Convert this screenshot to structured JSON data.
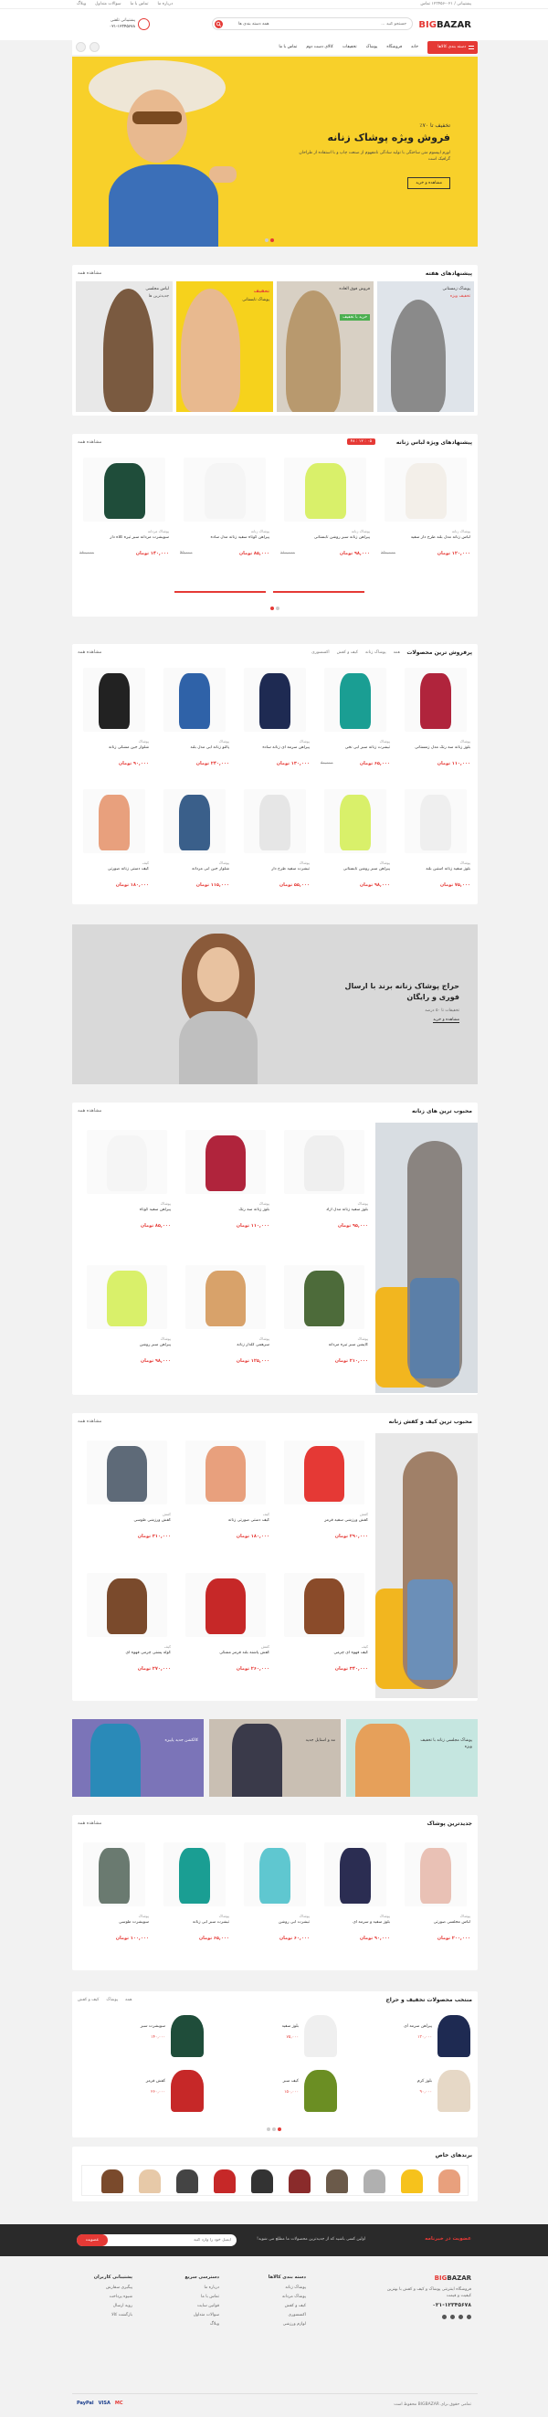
{
  "topbar": {
    "right_text": "پشتیبانی / ۰۲۱-۱۲۳۴۵۶ تماس",
    "left_links": [
      "درباره ما",
      "تماس با ما",
      "سوالات متداول",
      "وبلاگ"
    ]
  },
  "header": {
    "logo": "BIGBAZAR",
    "search_placeholder": "جستجو کنید ...",
    "category_select": "همه دسته بندی ها",
    "support_line1": "پشتیبانی تلفنی",
    "support_line2": "۰۲۱-۱۲۳۴۵۶۷۸"
  },
  "nav": {
    "all_categories": "دسته بندی کالاها",
    "items": [
      "خانه",
      "فروشگاه",
      "پوشاک",
      "تخفیفات",
      "کالای دست دوم",
      "تماس با ما"
    ]
  },
  "hero": {
    "subtitle": "تخفیف تا ۷۰٪",
    "title": "فروش ویژه پوشاک زنانه",
    "desc": "لورم ایپسوم متن ساختگی با تولید سادگی نامفهوم از صنعت چاپ و با استفاده از طراحان گرافیک است",
    "button": "مشاهده و خرید"
  },
  "special": {
    "title": "پیشنهادهای هفته",
    "see_all": "مشاهده همه",
    "tiles": [
      {
        "line1": "پوشاک زمستانی",
        "line2": "تخفیف ویژه",
        "bg": "#dfe4ea"
      },
      {
        "line1": "فروش فوق العاده",
        "line2": "خرید با تخفیف",
        "bg": "#d8d0c4"
      },
      {
        "line1": "تخفیف",
        "line2": "پوشاک تابستانی",
        "bg": "#f6d21c"
      },
      {
        "line1": "لباس مجلسی",
        "line2": "جدیدترین ها",
        "bg": "#e8e8e8"
      }
    ]
  },
  "amazing": {
    "title": "پیشنهادهای ویژه لباس زنانه",
    "timer": "۰۵ : ۱۲ : ۴۸",
    "see_all": "مشاهده همه",
    "products": [
      {
        "cat": "پوشاک زنانه",
        "title": "لباس زنانه مدل بلند طرح دار سفید",
        "price": "۱۲۰,۰۰۰ تومان",
        "old": "۱۵۰,۰۰۰",
        "color": "#f3efe9"
      },
      {
        "cat": "پوشاک زنانه",
        "title": "پیراهن زنانه سبز روشن تابستانی",
        "price": "۹۸,۰۰۰ تومان",
        "old": "۱۱۰,۰۰۰",
        "color": "#d9f06a"
      },
      {
        "cat": "پوشاک زنانه",
        "title": "پیراهن کوتاه سفید زنانه مدل ساده",
        "price": "۸۵,۰۰۰ تومان",
        "old": "۹۵,۰۰۰",
        "color": "#f5f5f5"
      },
      {
        "cat": "پوشاک مردانه",
        "title": "سویشرت مردانه سبز تیره کلاه دار",
        "price": "۱۴۰,۰۰۰ تومان",
        "old": "۱۶۰,۰۰۰",
        "color": "#1f4d3a"
      }
    ]
  },
  "bestsellers": {
    "title": "پرفروش ترین محصولات",
    "tabs": [
      "همه",
      "پوشاک زنانه",
      "کیف و کفش",
      "اکسسوری"
    ],
    "see_all": "مشاهده همه",
    "products": [
      {
        "cat": "پوشاک",
        "title": "بلوز زنانه سه رنگ مدل زمستانی",
        "price": "۱۱۰,۰۰۰ تومان",
        "old": "",
        "color": "#b0243c"
      },
      {
        "cat": "پوشاک",
        "title": "تیشرت زنانه سبز آبی نخی",
        "price": "۶۵,۰۰۰ تومان",
        "old": "۸۰,۰۰۰",
        "color": "#1a9e93"
      },
      {
        "cat": "پوشاک",
        "title": "پیراهن سرمه ای زنانه ساده",
        "price": "۱۳۰,۰۰۰ تومان",
        "old": "",
        "color": "#1e2a52"
      },
      {
        "cat": "پوشاک",
        "title": "پالتو زنانه آبی مدل بلند",
        "price": "۲۴۰,۰۰۰ تومان",
        "old": "",
        "color": "#2f62a8"
      },
      {
        "cat": "پوشاک",
        "title": "شلوار جین مشکی زنانه",
        "price": "۹۰,۰۰۰ تومان",
        "old": "",
        "color": "#222222"
      },
      {
        "cat": "پوشاک",
        "title": "بلوز سفید زنانه آستین بلند",
        "price": "۷۵,۰۰۰ تومان",
        "old": "",
        "color": "#efefef"
      },
      {
        "cat": "پوشاک",
        "title": "پیراهن سبز روشن تابستانی",
        "price": "۹۸,۰۰۰ تومان",
        "old": "",
        "color": "#d9f06a"
      },
      {
        "cat": "پوشاک",
        "title": "تیشرت سفید طرح دار",
        "price": "۵۵,۰۰۰ تومان",
        "old": "",
        "color": "#e6e6e6"
      },
      {
        "cat": "پوشاک",
        "title": "شلوار جین آبی مردانه",
        "price": "۱۱۵,۰۰۰ تومان",
        "old": "",
        "color": "#3a5f8a"
      },
      {
        "cat": "کیف",
        "title": "کیف دستی زنانه صورتی",
        "price": "۱۸۰,۰۰۰ تومان",
        "old": "",
        "color": "#e8a07d"
      }
    ]
  },
  "promo": {
    "title": "حراج پوشاک زنانه برند با ارسال فوری و رایگان",
    "subtitle": "تخفیفات تا ۵۰ درصد",
    "link": "مشاهده و خرید"
  },
  "women": {
    "title": "محبوب ترین های زنانه",
    "see_all": "مشاهده همه",
    "products": [
      {
        "cat": "پوشاک",
        "title": "بلوز سفید زنانه مدل آزاد",
        "price": "۹۵,۰۰۰ تومان",
        "color": "#efefef"
      },
      {
        "cat": "پوشاک",
        "title": "بلوز زنانه سه رنگ",
        "price": "۱۱۰,۰۰۰ تومان",
        "color": "#b0243c"
      },
      {
        "cat": "پوشاک",
        "title": "پیراهن سفید کوتاه",
        "price": "۸۵,۰۰۰ تومان",
        "color": "#f5f5f5"
      },
      {
        "cat": "پوشاک",
        "title": "کاپشن سبز تیره مردانه",
        "price": "۲۱۰,۰۰۰ تومان",
        "color": "#4d6b3a"
      },
      {
        "cat": "پوشاک",
        "title": "سرهمی گلدار زنانه",
        "price": "۱۲۵,۰۰۰ تومان",
        "color": "#d8a26a"
      },
      {
        "cat": "پوشاک",
        "title": "پیراهن سبز روشن",
        "price": "۹۸,۰۰۰ تومان",
        "color": "#d9f06a"
      }
    ]
  },
  "bags": {
    "title": "محبوب ترین کیف و کفش زنانه",
    "see_all": "مشاهده همه",
    "products": [
      {
        "cat": "کفش",
        "title": "کفش ورزشی سفید قرمز",
        "price": "۲۹۰,۰۰۰ تومان",
        "color": "#e53935"
      },
      {
        "cat": "کیف",
        "title": "کیف دستی صورتی زنانه",
        "price": "۱۸۰,۰۰۰ تومان",
        "color": "#e8a07d"
      },
      {
        "cat": "کفش",
        "title": "کفش ورزشی طوسی",
        "price": "۳۱۰,۰۰۰ تومان",
        "color": "#5e6a78"
      },
      {
        "cat": "کیف",
        "title": "کیف قهوه ای چرمی",
        "price": "۳۴۰,۰۰۰ تومان",
        "color": "#8a4b2a"
      },
      {
        "cat": "کفش",
        "title": "کفش پاشنه بلند قرمز مشکی",
        "price": "۲۶۰,۰۰۰ تومان",
        "color": "#c62828"
      },
      {
        "cat": "کیف",
        "title": "کوله پشتی چرمی قهوه ای",
        "price": "۲۷۰,۰۰۰ تومان",
        "color": "#7a4a2c"
      }
    ]
  },
  "banners3": [
    {
      "text": "پوشاک مجلسی زنانه با تخفیف ویژه",
      "bg": "#c5e6e0"
    },
    {
      "text": "مد و استایل جدید",
      "bg": "#c9bfb3"
    },
    {
      "text": "کالکشن جدید پاییزه",
      "bg": "#7b74b8"
    }
  ],
  "newest": {
    "title": "جدیدترین پوشاک",
    "see_all": "مشاهده همه",
    "products": [
      {
        "cat": "پوشاک",
        "title": "لباس مجلسی صورتی",
        "price": "۲۰۰,۰۰۰ تومان",
        "color": "#e9c1b5"
      },
      {
        "cat": "پوشاک",
        "title": "بلوز سفید و سرمه ای",
        "price": "۹۰,۰۰۰ تومان",
        "color": "#2b2d52"
      },
      {
        "cat": "پوشاک",
        "title": "تیشرت آبی روشن",
        "price": "۶۰,۰۰۰ تومان",
        "color": "#5fc7d0"
      },
      {
        "cat": "پوشاک",
        "title": "تیشرت سبز آبی زنانه",
        "price": "۶۵,۰۰۰ تومان",
        "color": "#1a9e93"
      },
      {
        "cat": "پوشاک",
        "title": "سویشرت طوسی",
        "price": "۱۰۰,۰۰۰ تومان",
        "color": "#6a7a70"
      }
    ]
  },
  "lists": {
    "title": "منتخب محصولات تخفیف و حراج",
    "tabs": [
      "همه",
      "پوشاک",
      "کیف و کفش"
    ],
    "items": [
      {
        "title": "پیراهن سرمه ای",
        "price": "۱۳۰,۰۰۰",
        "color": "#1e2a52"
      },
      {
        "title": "بلوز سفید",
        "price": "۷۵,۰۰۰",
        "color": "#efefef"
      },
      {
        "title": "سویشرت سبز",
        "price": "۱۴۰,۰۰۰",
        "color": "#1f4d3a"
      },
      {
        "title": "بلوز کرم",
        "price": "۹۰,۰۰۰",
        "color": "#e6d8c6"
      },
      {
        "title": "کیف سبز",
        "price": "۱۵۰,۰۰۰",
        "color": "#6b8e23"
      },
      {
        "title": "کفش قرمز",
        "price": "۲۶۰,۰۰۰",
        "color": "#c62828"
      }
    ]
  },
  "brands": {
    "title": "برندهای خاص",
    "items": [
      "#e8a07d",
      "#f6c21c",
      "#b0b0b0",
      "#6b5a4a",
      "#8a2b2b",
      "#333333",
      "#c62828",
      "#444444",
      "#e7c9a8",
      "#7a4a2c"
    ]
  },
  "newsletter": {
    "title": "عضویت در خبرنامه",
    "desc": "اولین کسی باشید که از جدیدترین محصولات ما مطلع می شوید!",
    "placeholder": "ایمیل خود را وارد کنید",
    "button": "عضویت"
  },
  "footer": {
    "logo": "BIGBAZAR",
    "about": "فروشگاه اینترنتی پوشاک و کیف و کفش با بهترین کیفیت و قیمت",
    "phone": "۰۲۱-۱۲۳۴۵۶۷۸",
    "col1_title": "دسته بندی کالاها",
    "col1": [
      "پوشاک زنانه",
      "پوشاک مردانه",
      "کیف و کفش",
      "اکسسوری",
      "لوازم ورزشی"
    ],
    "col2_title": "دسترسی سریع",
    "col2": [
      "درباره ما",
      "تماس با ما",
      "قوانین سایت",
      "سوالات متداول",
      "وبلاگ"
    ],
    "col3_title": "پشتیبانی کاربران",
    "col3": [
      "پیگیری سفارش",
      "شیوه پرداخت",
      "رویه ارسال",
      "بازگشت کالا"
    ],
    "copyright": "تمامی حقوق برای BIGBAZAR محفوظ است",
    "payments": [
      "PayPal",
      "VISA",
      "MC"
    ]
  }
}
